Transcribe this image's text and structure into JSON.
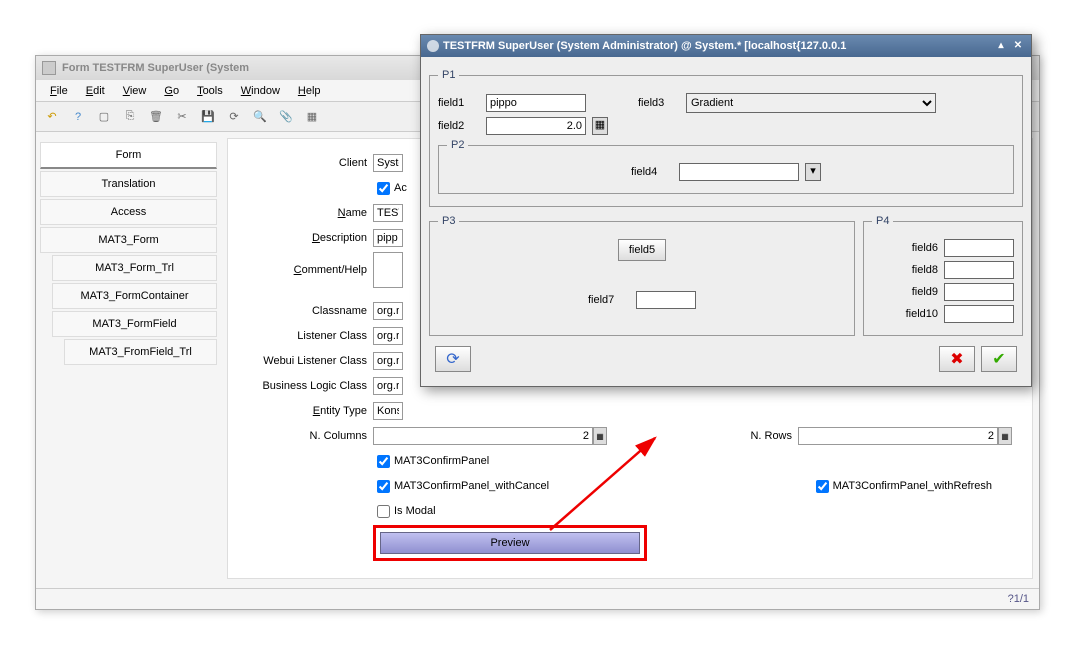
{
  "main_window": {
    "title": "Form  TESTFRM  SuperUser (System",
    "menus": [
      "File",
      "Edit",
      "View",
      "Go",
      "Tools",
      "Window",
      "Help"
    ],
    "tabs": [
      "Form",
      "Translation",
      "Access",
      "MAT3_Form",
      "MAT3_Form_Trl",
      "MAT3_FormContainer",
      "MAT3_FormField",
      "MAT3_FromField_Trl"
    ],
    "form": {
      "client_label": "Client",
      "client_value": "Syste",
      "active_label": "Ac",
      "name_label": "Name",
      "name_value": "TEST",
      "description_label": "Description",
      "description_value": "pipp",
      "comment_label": "Comment/Help",
      "classname_label": "Classname",
      "classname_value": "org.r",
      "listener_label": "Listener Class",
      "listener_value": "org.r",
      "webui_label": "Webui Listener Class",
      "webui_value": "org.r",
      "biz_label": "Business Logic Class",
      "biz_value": "org.r",
      "entity_label": "Entity Type",
      "entity_value": "Kons",
      "ncols_label": "N. Columns",
      "ncols_value": "2",
      "nrows_label": "N. Rows",
      "nrows_value": "2",
      "cb1": "MAT3ConfirmPanel",
      "cb2": "MAT3ConfirmPanel_withCancel",
      "cb3": "MAT3ConfirmPanel_withRefresh",
      "cb4": "Is Modal",
      "preview": "Preview"
    },
    "status": "?1/1"
  },
  "dialog": {
    "title": "TESTFRM  SuperUser (System Administrator) @ System.* [localhost{127.0.0.1",
    "p1": "P1",
    "p2": "P2",
    "p3": "P3",
    "p4": "P4",
    "field1_label": "field1",
    "field1_value": "pippo",
    "field2_label": "field2",
    "field2_value": "2.0",
    "field3_label": "field3",
    "field3_value": "Gradient",
    "field4_label": "field4",
    "field5_label": "field5",
    "field7_label": "field7",
    "field6_label": "field6",
    "field8_label": "field8",
    "field9_label": "field9",
    "field10_label": "field10"
  }
}
